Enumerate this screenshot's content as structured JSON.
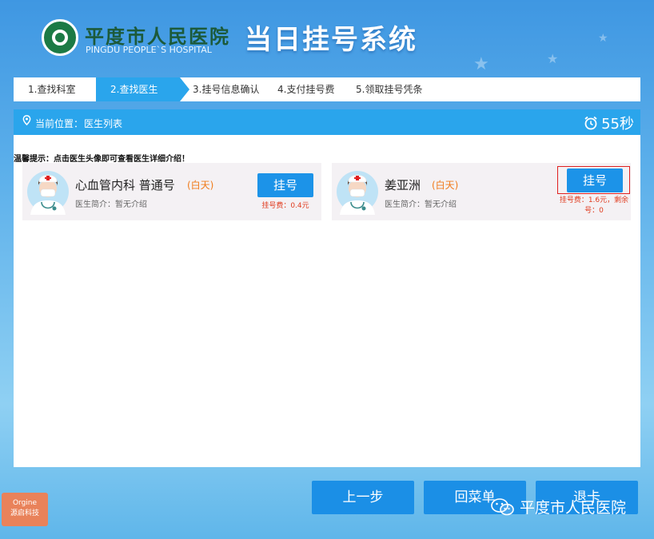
{
  "header": {
    "hospital_cn": "平度市人民医院",
    "hospital_en": "PINGDU PEOPLE`S HOSPITAL",
    "system_title": "当日挂号系统"
  },
  "steps": [
    {
      "label": "1.查找科室",
      "active": false
    },
    {
      "label": "2.查找医生",
      "active": true
    },
    {
      "label": "3.挂号信息确认",
      "active": false
    },
    {
      "label": "4.支付挂号费",
      "active": false
    },
    {
      "label": "5.领取挂号凭条",
      "active": false
    }
  ],
  "location": {
    "label": "当前位置：",
    "value": "医生列表",
    "countdown": "55秒"
  },
  "tip": "温馨提示：点击医生头像即可查看医生详细介绍！",
  "doctors": [
    {
      "name": "心血管内科 普通号",
      "shift": "(白天)",
      "intro": "医生简介：暂无介绍",
      "button": "挂号",
      "fee": "挂号费：0.4元"
    },
    {
      "name": "姜亚洲",
      "shift": "(白天)",
      "intro": "医生简介：暂无介绍",
      "button": "挂号",
      "fee_line1": "挂号费：1.6元，剩余",
      "fee_line2": "号：0"
    }
  ],
  "bottom": {
    "prev": "上一步",
    "menu": "回菜单",
    "exit": "退卡"
  },
  "corner_logo": {
    "line1": "Orgine",
    "line2": "源启科技"
  },
  "watermark": "平度市人民医院",
  "colors": {
    "accent": "#2aa5ec",
    "button": "#1b8fe6",
    "fee": "#e03c1f",
    "shift": "#f07b1a"
  }
}
